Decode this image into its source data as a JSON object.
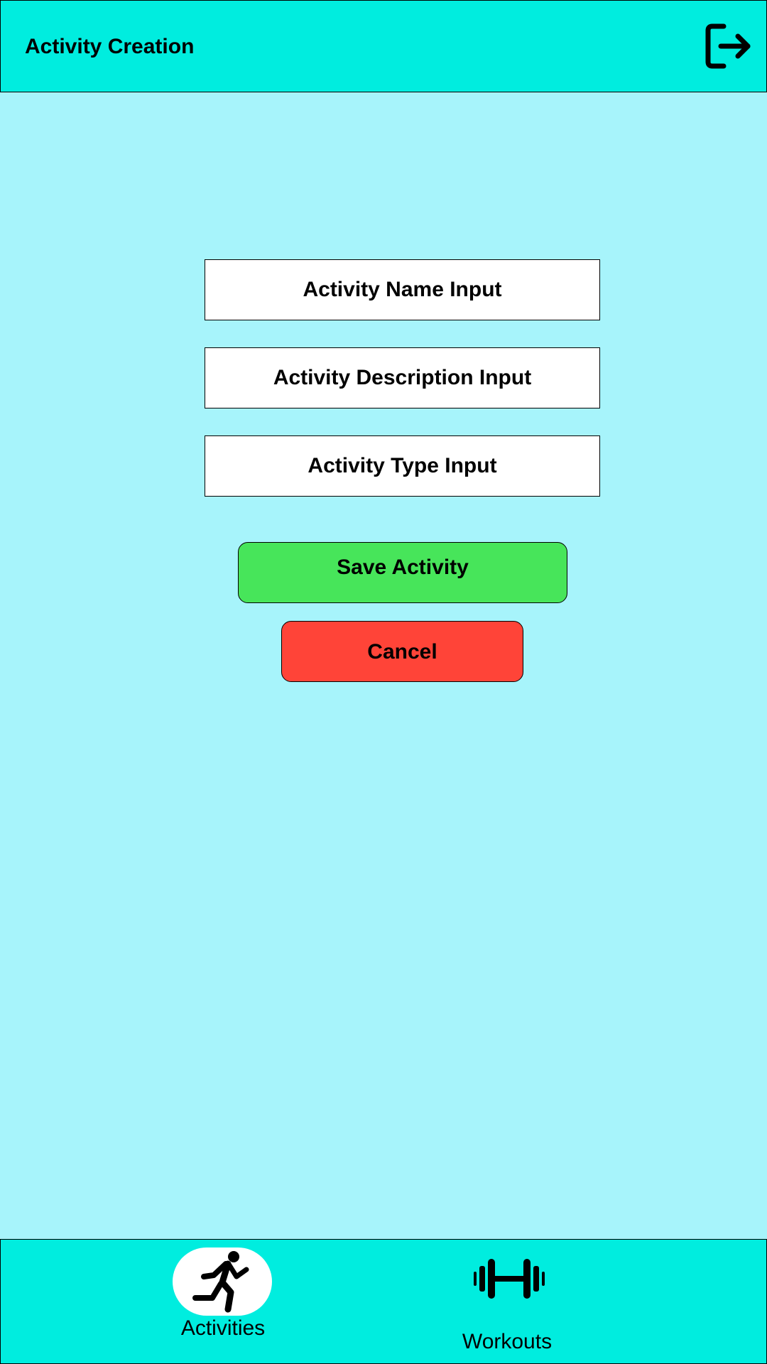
{
  "header": {
    "title": "Activity Creation",
    "logout_icon": "logout-icon"
  },
  "form": {
    "name_placeholder": "Activity Name Input",
    "description_placeholder": "Activity Description Input",
    "type_placeholder": "Activity Type Input",
    "save_label": "Save Activity",
    "cancel_label": "Cancel"
  },
  "nav": {
    "items": [
      {
        "label": "Activities",
        "icon": "running-icon",
        "active": true
      },
      {
        "label": "Workouts",
        "icon": "dumbbell-icon",
        "active": false
      }
    ]
  },
  "colors": {
    "background": "#a7f4fb",
    "bar": "#00eddf",
    "save": "#47e55a",
    "cancel": "#ff4438"
  }
}
